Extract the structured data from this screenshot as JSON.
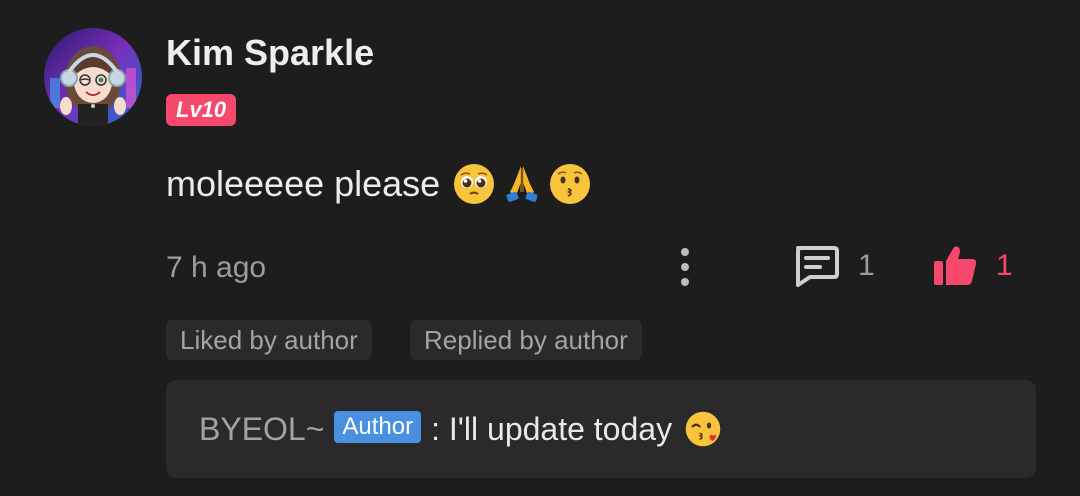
{
  "colors": {
    "background": "#1d1d1d",
    "accent_pink": "#f5486c",
    "author_badge": "#4a90e2",
    "tag_bg": "#2a2a2a"
  },
  "user": {
    "name": "Kim Sparkle",
    "level": "Lv10"
  },
  "comment": {
    "text": "moleeeee please",
    "emojis": [
      "pleading-face-icon",
      "folded-hands-icon",
      "kissing-face-icon"
    ],
    "time": "7 h ago",
    "reply_count": "1",
    "like_count": "1"
  },
  "tags": [
    "Liked by author",
    "Replied by author"
  ],
  "reply": {
    "author": "BYEOL~",
    "badge": "Author",
    "text": ": I'll update today",
    "emoji": "face-blowing-kiss-icon"
  }
}
